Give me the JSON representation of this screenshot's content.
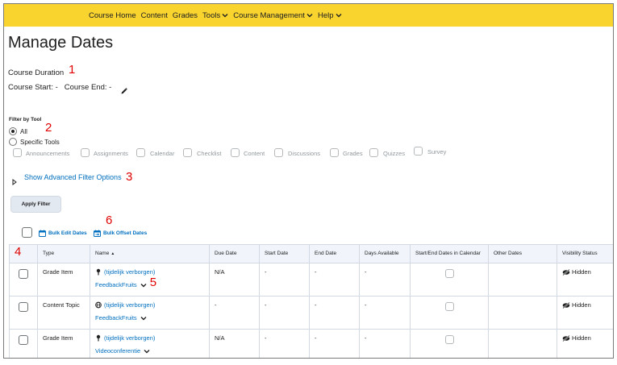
{
  "nav": {
    "items": [
      {
        "label": "Course Home",
        "dropdown": false
      },
      {
        "label": "Content",
        "dropdown": false
      },
      {
        "label": "Grades",
        "dropdown": false
      },
      {
        "label": "Tools",
        "dropdown": true
      },
      {
        "label": "Course Management",
        "dropdown": true
      },
      {
        "label": "Help",
        "dropdown": true
      }
    ],
    "bar_color": "#f9d32e"
  },
  "page": {
    "title": "Manage Dates"
  },
  "duration": {
    "heading": "Course Duration",
    "annotation": "1",
    "start_label": "Course Start:",
    "start_value": "-",
    "end_label": "Course End:",
    "end_value": "-",
    "edit_icon": "pencil-icon"
  },
  "filter": {
    "label": "Filter by Tool",
    "annotation": "2",
    "option_all": "All",
    "option_specific": "Specific Tools",
    "selected": "All",
    "tools": [
      "Announcements",
      "Assignments",
      "Calendar",
      "Checklist",
      "Content",
      "Discussions",
      "Grades",
      "Quizzes",
      "Survey"
    ]
  },
  "advanced": {
    "link": "Show Advanced Filter Options",
    "annotation": "3"
  },
  "apply_button": "Apply Filter",
  "bulk": {
    "annotation": "6",
    "edit_label": "Bulk Edit Dates",
    "offset_label": "Bulk Offset Dates"
  },
  "table": {
    "select_annotation": "4",
    "headers": {
      "type": "Type",
      "name": "Name",
      "name_sort": "▲",
      "due": "Due Date",
      "start": "Start Date",
      "end": "End Date",
      "days": "Days Available",
      "calendar": "Start/End Dates in Calendar",
      "other": "Other Dates",
      "visibility": "Visibility Status"
    },
    "rows": [
      {
        "type": "Grade Item",
        "icon": "grade-item-icon",
        "name": "(tijdelijk verborgen)",
        "tool": "FeedbackFruits",
        "annotation": "5",
        "due": "N/A",
        "start": "-",
        "end": "-",
        "days": "-",
        "visibility": "Hidden"
      },
      {
        "type": "Content Topic",
        "icon": "globe-icon",
        "name": "(tijdelijk verborgen)",
        "tool": "FeedbackFruits",
        "annotation": "",
        "due": "-",
        "start": "-",
        "end": "-",
        "days": "-",
        "visibility": "Hidden"
      },
      {
        "type": "Grade Item",
        "icon": "grade-item-icon",
        "name": "(tijdelijk verborgen)",
        "tool": "Videoconferentie",
        "annotation": "",
        "due": "N/A",
        "start": "-",
        "end": "-",
        "days": "-",
        "visibility": "Hidden"
      }
    ]
  },
  "colors": {
    "link": "#006fbf",
    "annotation": "#e00000",
    "header_bg": "#f1f5fb"
  }
}
